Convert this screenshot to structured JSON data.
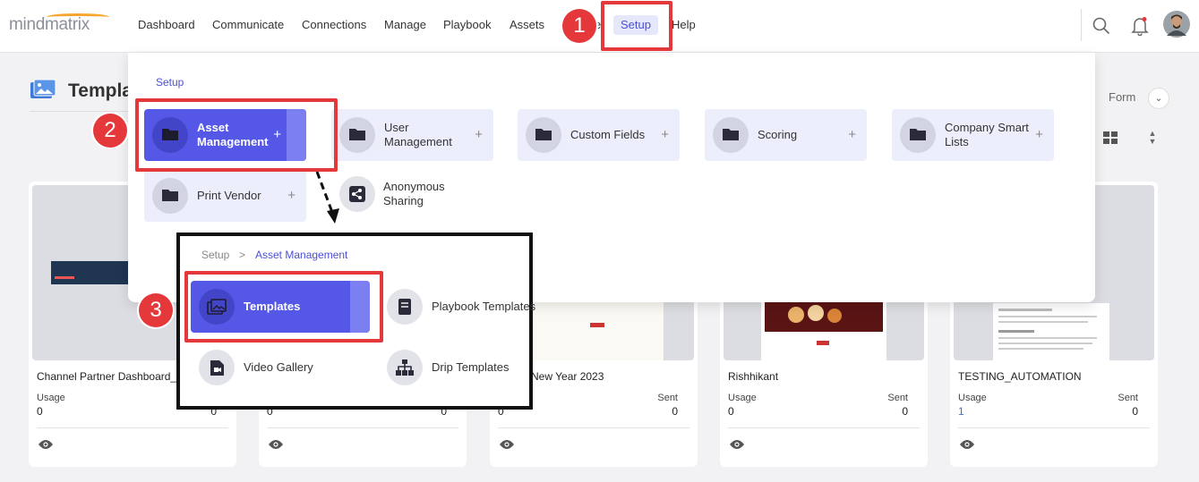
{
  "nav": {
    "logo": "mindmatrix",
    "items": [
      "Dashboard",
      "Communicate",
      "Connections",
      "Manage",
      "Playbook",
      "Assets"
    ],
    "hidden_item": "e",
    "setup": "Setup",
    "help": "Help"
  },
  "page": {
    "title": "Templa",
    "form_label": "Form"
  },
  "dropdown": {
    "breadcrumb": "Setup",
    "tiles": [
      {
        "label": "Asset Management",
        "plus": "+"
      },
      {
        "label": "User Management",
        "plus": "+"
      },
      {
        "label": "Custom Fields",
        "plus": "+"
      },
      {
        "label": "Scoring",
        "plus": "+"
      },
      {
        "label": "Company Smart Lists",
        "plus": "+"
      },
      {
        "label": "Print Vendor",
        "plus": "+"
      }
    ],
    "anonymous_sharing": "Anonymous Sharing"
  },
  "submenu": {
    "crumb_root": "Setup",
    "crumb_sep": ">",
    "crumb_current": "Asset Management",
    "items": [
      "Templates",
      "Playbook Templates",
      "Video Gallery",
      "Drip Templates"
    ]
  },
  "cards": [
    {
      "name": "Channel Partner Dashboard_C",
      "usage_label": "Usage",
      "usage": "0",
      "sent_label": "",
      "sent": "0"
    },
    {
      "name": "",
      "usage_label": "",
      "usage": "0",
      "sent_label": "",
      "sent": "0"
    },
    {
      "name": "New Year 2023",
      "usage_label": "",
      "usage": "0",
      "sent_label": "Sent",
      "sent": "0"
    },
    {
      "name": "Rishhikant",
      "usage_label": "Usage",
      "usage": "0",
      "sent_label": "Sent",
      "sent": "0"
    },
    {
      "name": "TESTING_AUTOMATION",
      "usage_label": "Usage",
      "usage": "1",
      "sent_label": "Sent",
      "sent": "0"
    }
  ],
  "annotations": [
    "1",
    "2",
    "3"
  ],
  "colors": {
    "accent": "#5558e6",
    "annotation_red": "#e5383b"
  }
}
